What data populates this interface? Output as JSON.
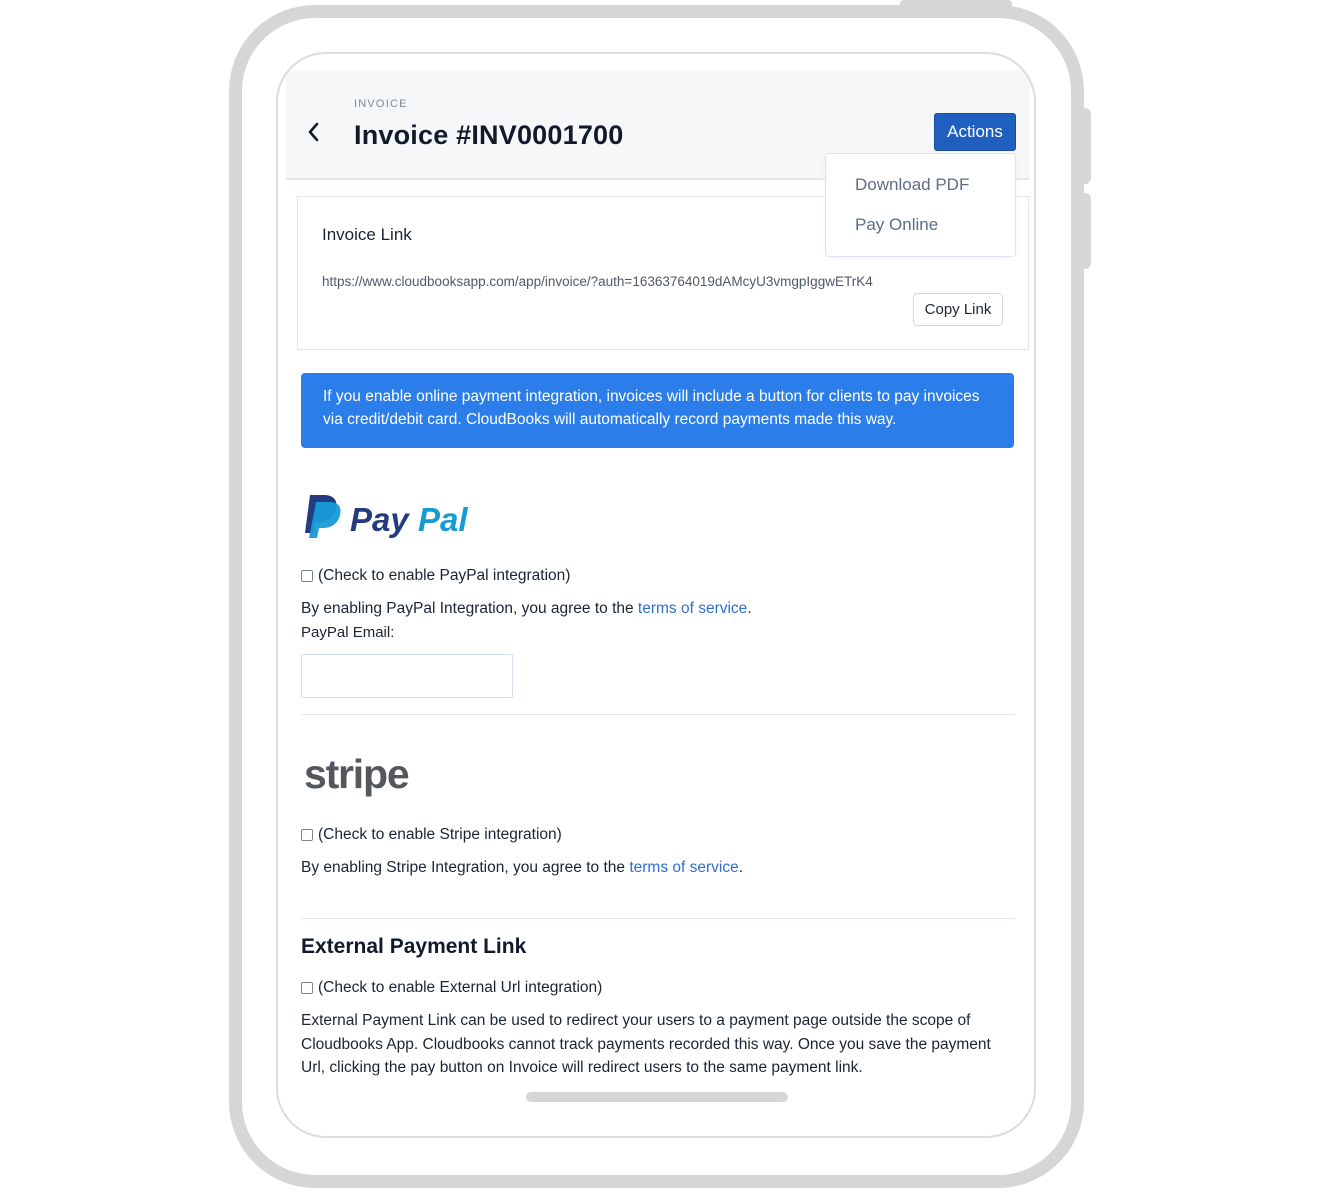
{
  "header": {
    "eyebrow": "INVOICE",
    "title": "Invoice #INV0001700",
    "actions_label": "Actions"
  },
  "actions_menu": {
    "items": [
      {
        "label": "Download PDF"
      },
      {
        "label": "Pay Online"
      }
    ]
  },
  "invoice_link": {
    "label": "Invoice Link",
    "url": "https://www.cloudbooksapp.com/app/invoice/?auth=16363764019dAMcyU3vmgpIggwETrK4",
    "copy_label": "Copy Link"
  },
  "info_banner": {
    "text": "If you enable online payment integration, invoices will include a button for clients to pay invoices via credit/debit card. CloudBooks will automatically record payments made this way."
  },
  "paypal": {
    "logo_text_pay": "Pay",
    "logo_text_pal": "Pal",
    "checkbox_label": "(Check to enable PayPal integration)",
    "checked": false,
    "agree_text": "By enabling PayPal Integration, you agree to the ",
    "tos_label": "terms of service",
    "period": ".",
    "email_label": "PayPal Email:",
    "email_value": ""
  },
  "stripe": {
    "logo_text": "stripe",
    "checkbox_label": "(Check to enable Stripe integration)",
    "checked": false,
    "agree_text": "By enabling Stripe Integration, you agree to the ",
    "tos_label": "terms of service",
    "period": "."
  },
  "external": {
    "heading": "External Payment Link",
    "checkbox_label": "(Check to enable External Url integration)",
    "checked": false,
    "description": "External Payment Link can be used to redirect your users to a payment page outside the scope of Cloudbooks App. Cloudbooks cannot track payments recorded this way. Once you save the payment Url, clicking the pay button on Invoice will redirect users to the same payment link."
  },
  "colors": {
    "primary": "#1f5fbf",
    "banner": "#2b7de9",
    "link": "#2f6fd1",
    "paypal_dark": "#253b80",
    "paypal_light": "#179bd7",
    "stripe_gray": "#54585e"
  },
  "icons": {
    "back": "chevron-left-icon"
  }
}
